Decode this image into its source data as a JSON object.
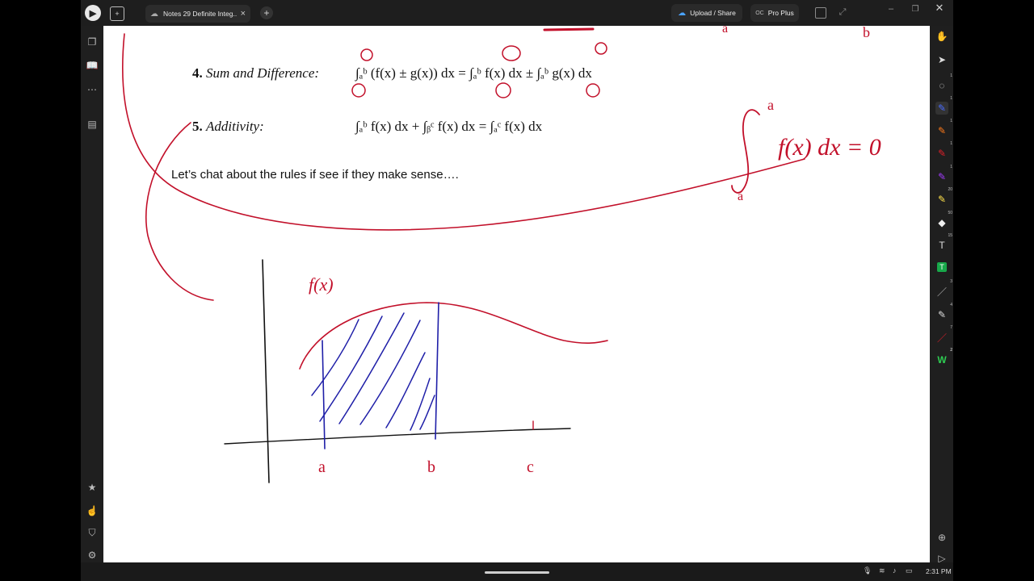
{
  "app": {
    "tab_title": "Notes 29 Definite Integ...*",
    "upload_label": "Upload / Share",
    "pro_label": "Pro Plus",
    "pro_badge": "OC"
  },
  "document": {
    "rule4": {
      "number": "4.",
      "name": "Sum and Difference:",
      "formula_lhs": "∫ₐᵇ (f(x) ± g(x)) dx",
      "formula_rhs": "∫ₐᵇ f(x) dx ± ∫ₐᵇ g(x) dx"
    },
    "rule5": {
      "number": "5.",
      "name": "Additivity:",
      "formula_lhs": "∫ₐᵇ f(x) dx + ∫ᵦᶜ f(x) dx",
      "formula_rhs": "∫ₐᶜ f(x) dx"
    },
    "chat_text": "Let’s chat about the rules if see if they make sense…."
  },
  "ink": {
    "colors": {
      "red": "#c2102a",
      "blue": "#1f1fa8"
    },
    "labels": {
      "fx": "f(x)",
      "a": "a",
      "b": "b",
      "c": "c",
      "integral_expr": "f(x) dx = 0",
      "integral_upper": "a",
      "integral_lower": "a"
    }
  },
  "toolbar": {
    "tools": [
      {
        "name": "hand",
        "count": ""
      },
      {
        "name": "select",
        "count": ""
      },
      {
        "name": "lasso",
        "count": "1"
      },
      {
        "name": "pen-blue",
        "count": "1"
      },
      {
        "name": "highlighter-orange",
        "count": "1"
      },
      {
        "name": "pen-red",
        "count": "1"
      },
      {
        "name": "pen-purple",
        "count": "1"
      },
      {
        "name": "highlighter-yellow",
        "count": "20"
      },
      {
        "name": "eraser",
        "count": "50"
      },
      {
        "name": "text-add",
        "count": "15"
      },
      {
        "name": "text",
        "count": ""
      },
      {
        "name": "line",
        "count": "3"
      },
      {
        "name": "pen-multi",
        "count": "4"
      },
      {
        "name": "pen-red-2",
        "count": "7"
      },
      {
        "name": "handwriting",
        "count": "2"
      }
    ]
  },
  "status": {
    "time": "2:31 PM"
  }
}
